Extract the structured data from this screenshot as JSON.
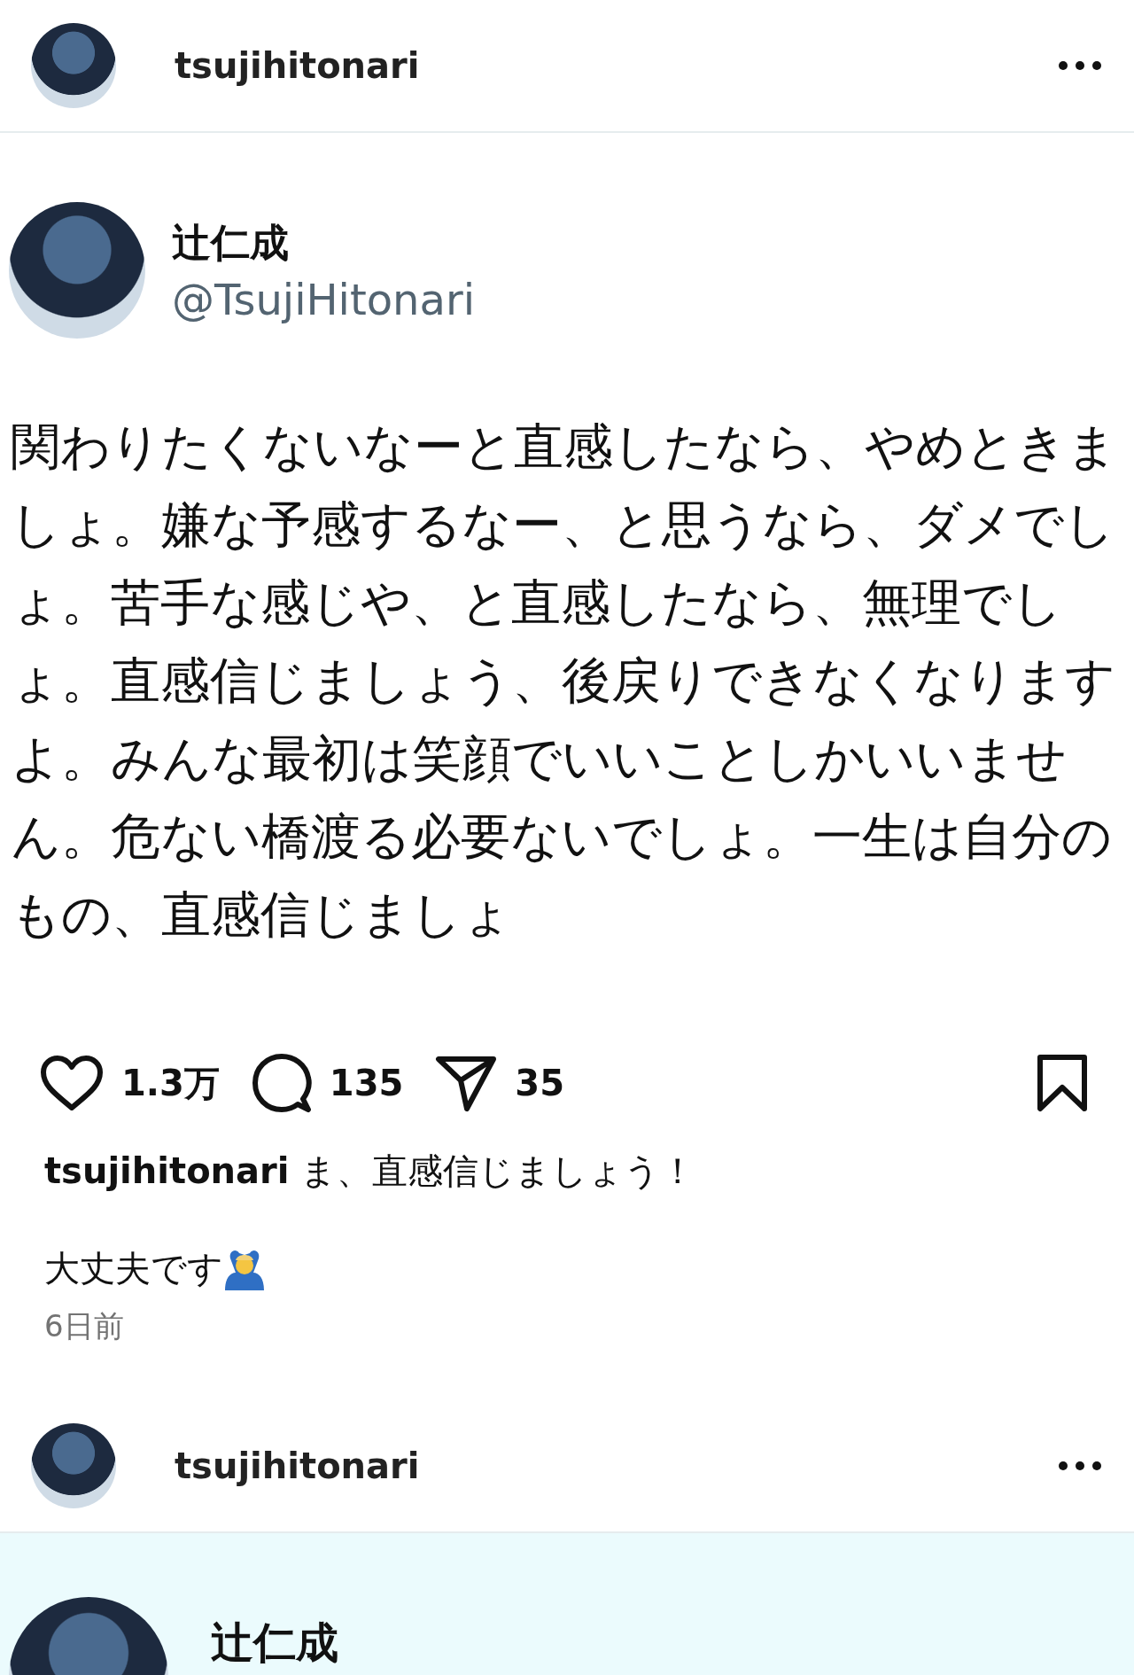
{
  "post_header": {
    "username": "tsujihitonari"
  },
  "tweet_card": {
    "name": "辻仁成",
    "handle": "@TsujiHitonari",
    "text": "関わりたくないなーと直感したなら、やめときましょ。嫌な予感するなー、と思うなら、ダメでしょ。苦手な感じや、と直感したなら、無理でしょ。直感信じましょう、後戻りできなくなりますよ。みんな最初は笑顔でいいことしかいいません。危ない橋渡る必要ないでしょ。一生は自分のもの、直感信じましょ"
  },
  "actions": {
    "likes": "1.3万",
    "comments": "135",
    "shares": "35"
  },
  "caption": {
    "text": "**tsujihitonari** ま、直感信じましょう！",
    "second_line": "大丈夫です"
  },
  "timestamp": "6日前",
  "next_post": {
    "username": "tsujihitonari",
    "name": "辻仁成"
  }
}
